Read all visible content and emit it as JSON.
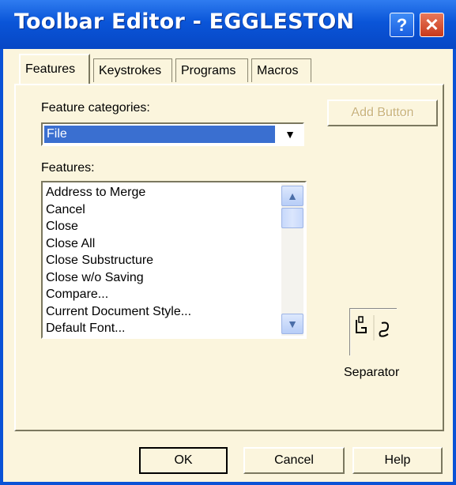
{
  "window": {
    "title": "Toolbar Editor - EGGLESTON",
    "help_glyph": "?",
    "close_glyph": "✕"
  },
  "tabs": [
    {
      "label": "Features",
      "active": true
    },
    {
      "label": "Keystrokes",
      "active": false
    },
    {
      "label": "Programs",
      "active": false
    },
    {
      "label": "Macros",
      "active": false
    }
  ],
  "feature_categories": {
    "label": "Feature categories:",
    "selected": "File",
    "arrow": "▼"
  },
  "features": {
    "label": "Features:",
    "items": [
      "Address to Merge",
      "Cancel",
      "Close",
      "Close All",
      "Close Substructure",
      "Close w/o Saving",
      "Compare...",
      "Current Document Style...",
      "Default Font..."
    ],
    "scroll_up": "▲",
    "scroll_down": "▼"
  },
  "add_button": {
    "label": "Add Button",
    "enabled": false
  },
  "separator": {
    "label": "Separator"
  },
  "footer": {
    "ok_label": "OK",
    "cancel_label": "Cancel",
    "help_label": "Help"
  },
  "colors": {
    "titlebar": "#0a55d8",
    "dialog_bg": "#fbf5dd",
    "selection": "#3a6fd0",
    "close_button": "#c8391b"
  }
}
